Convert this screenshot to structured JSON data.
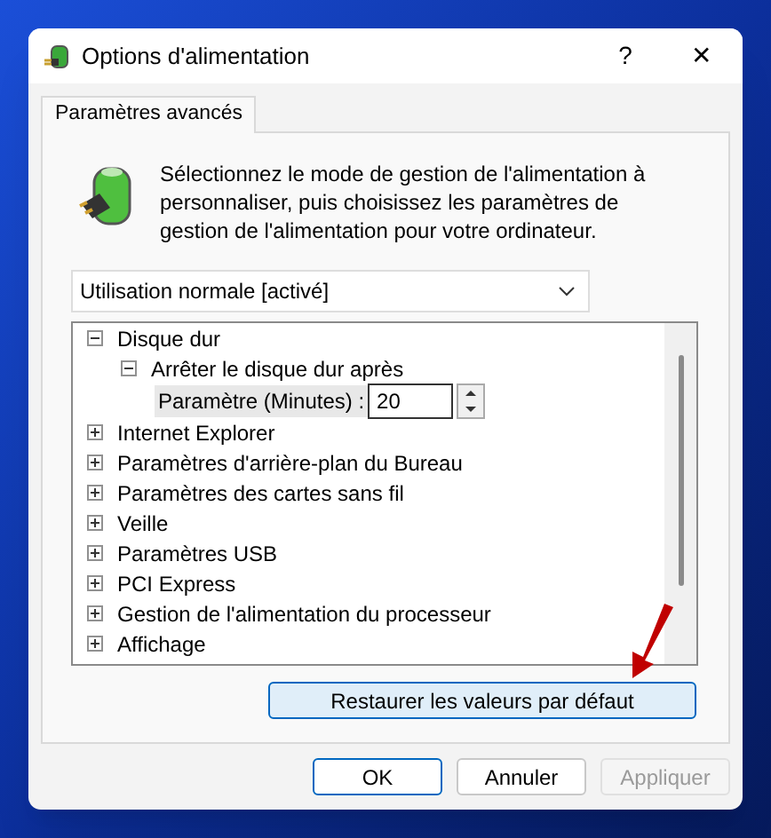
{
  "window": {
    "title": "Options d'alimentation",
    "help": "?",
    "close": "✕"
  },
  "tabs": [
    {
      "label": "Paramètres avancés",
      "selected": true
    }
  ],
  "description": "Sélectionnez le mode de gestion de l'alimentation à personnaliser, puis choisissez les paramètres de gestion de l'alimentation pour votre ordinateur.",
  "plan_dropdown": {
    "value": "Utilisation normale [activé]"
  },
  "tree": [
    {
      "label": "Disque dur",
      "expanded": true,
      "children": [
        {
          "label": "Arrêter le disque dur après",
          "expanded": true,
          "children": [
            {
              "kind": "setting",
              "label": "Paramètre (Minutes) :",
              "value": "20"
            }
          ]
        }
      ]
    },
    {
      "label": "Internet Explorer",
      "expanded": false
    },
    {
      "label": "Paramètres d'arrière-plan du Bureau",
      "expanded": false
    },
    {
      "label": "Paramètres des cartes sans fil",
      "expanded": false
    },
    {
      "label": "Veille",
      "expanded": false
    },
    {
      "label": "Paramètres USB",
      "expanded": false
    },
    {
      "label": "PCI Express",
      "expanded": false
    },
    {
      "label": "Gestion de l'alimentation du processeur",
      "expanded": false
    },
    {
      "label": "Affichage",
      "expanded": false
    }
  ],
  "restore_button": "Restaurer les valeurs par défaut",
  "buttons": [
    {
      "label": "OK",
      "kind": "default",
      "disabled": false
    },
    {
      "label": "Annuler",
      "kind": "normal",
      "disabled": false
    },
    {
      "label": "Appliquer",
      "kind": "normal",
      "disabled": true
    }
  ]
}
